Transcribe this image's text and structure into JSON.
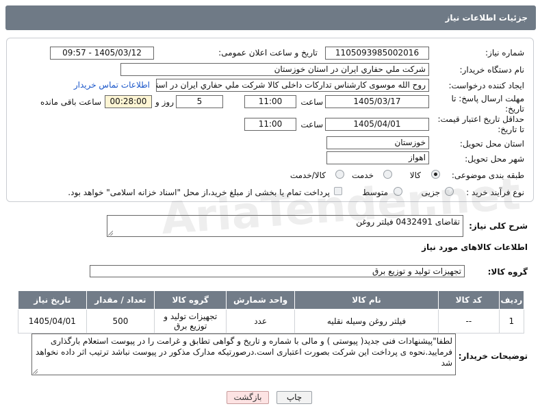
{
  "header": {
    "title": "جزئیات اطلاعات نیاز"
  },
  "form": {
    "need_number": {
      "label": "شماره نیاز:",
      "value": "1105093985002016"
    },
    "announce_datetime": {
      "label": "تاریخ و ساعت اعلان عمومی:",
      "value": "1405/03/12 - 09:57"
    },
    "buyer_org": {
      "label": "نام دستگاه خریدار:",
      "value": "شرکت ملي حفاري ايران در استان خوزستان"
    },
    "requester": {
      "label": "ایجاد کننده درخواست:",
      "value": "روح الله موسوی کارشناس تدارکات داخلی کالا شرکت ملي حفاري ايران در استان",
      "contact_link": "اطلاعات تماس خریدار"
    },
    "deadline": {
      "label": "مهلت ارسال پاسخ: تا تاریخ:",
      "date": "1405/03/17",
      "time_label": "ساعت",
      "time": "11:00",
      "days": "5",
      "days_label": "روز و",
      "remaining": "00:28:00",
      "remaining_label": "ساعت باقی مانده"
    },
    "price_validity": {
      "label": "حداقل تاریخ اعتبار قیمت: تا تاریخ:",
      "date": "1405/04/01",
      "time_label": "ساعت",
      "time": "11:00"
    },
    "delivery_province": {
      "label": "استان محل تحویل:",
      "value": "خوزستان"
    },
    "delivery_city": {
      "label": "شهر محل تحویل:",
      "value": "اهواز"
    },
    "category": {
      "label": "طبقه بندی موضوعی:",
      "options": [
        "کالا",
        "خدمت",
        "کالا/خدمت"
      ],
      "selected": "کالا"
    },
    "purchase_type": {
      "label": "نوع فرآیند خرید :",
      "options": [
        "جزیی",
        "متوسط"
      ],
      "payment_note": "پرداخت تمام یا بخشی از مبلغ خرید،از محل \"اسناد خزانه اسلامی\" خواهد بود."
    }
  },
  "summary": {
    "label": "شرح کلی نیاز:",
    "value": "تقاضای 0432491 فیلتر روغن"
  },
  "goods_section": {
    "title": "اطلاعات کالاهای مورد نیاز",
    "group_label": "گروه کالا:",
    "group_value": "تجهیزات تولید و توزیع برق"
  },
  "items_table": {
    "headers": [
      "ردیف",
      "کد کالا",
      "نام کالا",
      "واحد شمارش",
      "گروه کالا",
      "تعداد / مقدار",
      "تاریخ نیاز"
    ],
    "rows": [
      {
        "row": "1",
        "code": "--",
        "name": "فیلتر روغن وسیله نقلیه",
        "unit": "عدد",
        "group": "تجهیزات تولید و توزیع برق",
        "qty": "500",
        "date": "1405/04/01"
      }
    ]
  },
  "buyer_notes": {
    "label": "توضیحات خریدار:",
    "value": "لطفا\"پیشنهادات فنی جدید( پیوستی ) و مالی با شماره و تاریخ و گواهی تطابق و غرامت را در پیوست استعلام بارگذاری فرمایید.نحوه ی پرداخت این شرکت بصورت اعتباری است.درصورتیکه مدارک مذکور در پیوست نباشد ترتیب اثر داده نخواهد شد"
  },
  "buttons": {
    "print": "چاپ",
    "back": "بازگشت"
  },
  "colors": {
    "header_bg": "#6f7a86",
    "link": "#1a56c9",
    "highlight": "#fdf5d4"
  }
}
